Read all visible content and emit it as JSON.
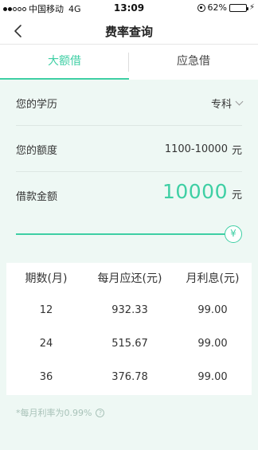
{
  "status_bar": {
    "carrier": "中国移动",
    "network": "4G",
    "time": "13:09",
    "battery_text": "62%",
    "battery_level": 0.62
  },
  "nav": {
    "title": "费率查询",
    "back_icon": "chevron-left-icon"
  },
  "tabs": [
    {
      "label": "大额借",
      "active": true
    },
    {
      "label": "应急借",
      "active": false
    }
  ],
  "form": {
    "education": {
      "label": "您的学历",
      "value": "专科"
    },
    "quota": {
      "label": "您的额度",
      "value": "1100-10000",
      "unit": "元"
    },
    "loan_amount": {
      "label": "借款金额",
      "value": "10000",
      "unit": "元"
    }
  },
  "slider": {
    "level": 1.0,
    "handle_glyph": "¥",
    "handle_icon": "yen-icon"
  },
  "table": {
    "headers": [
      "期数(月)",
      "每月应还(元)",
      "月利息(元)"
    ],
    "rows": [
      [
        "12",
        "932.33",
        "99.00"
      ],
      [
        "24",
        "515.67",
        "99.00"
      ],
      [
        "36",
        "376.78",
        "99.00"
      ]
    ]
  },
  "footnote": {
    "text": "*每月利率为0.99%",
    "help_glyph": "?"
  },
  "colors": {
    "accent": "#3ecfa4",
    "background": "#eef8f4",
    "battery": "#f5c518"
  }
}
